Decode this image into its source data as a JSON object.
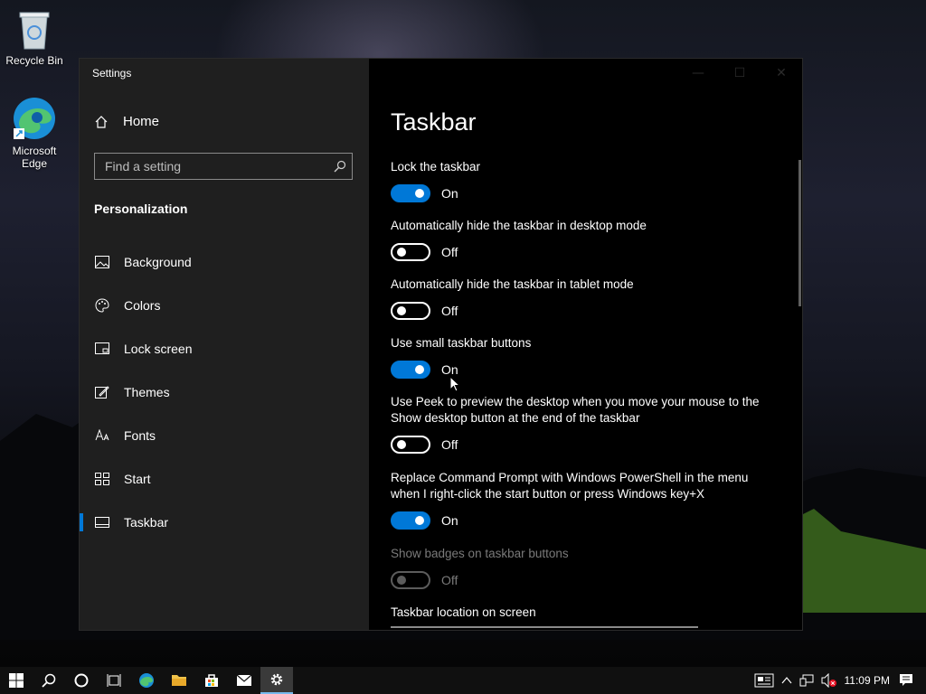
{
  "desktop": {
    "icons": [
      {
        "label": "Recycle Bin"
      },
      {
        "label_line1": "Microsoft",
        "label_line2": "Edge"
      }
    ]
  },
  "window": {
    "title": "Settings",
    "controls": {
      "minimize": "—",
      "maximize": "☐",
      "close": "✕"
    }
  },
  "nav": {
    "home_label": "Home",
    "search_placeholder": "Find a setting",
    "section_title": "Personalization",
    "items": [
      {
        "label": "Background",
        "icon": "picture-icon"
      },
      {
        "label": "Colors",
        "icon": "palette-icon"
      },
      {
        "label": "Lock screen",
        "icon": "lock-screen-icon"
      },
      {
        "label": "Themes",
        "icon": "themes-icon"
      },
      {
        "label": "Fonts",
        "icon": "fonts-icon"
      },
      {
        "label": "Start",
        "icon": "start-icon"
      },
      {
        "label": "Taskbar",
        "icon": "taskbar-icon",
        "active": true
      }
    ]
  },
  "content": {
    "title": "Taskbar",
    "settings": [
      {
        "label": "Lock the taskbar",
        "state": "On"
      },
      {
        "label": "Automatically hide the taskbar in desktop mode",
        "state": "Off"
      },
      {
        "label": "Automatically hide the taskbar in tablet mode",
        "state": "Off"
      },
      {
        "label": "Use small taskbar buttons",
        "state": "On"
      },
      {
        "label_line1": "Use Peek to preview the desktop when you move your mouse to the",
        "label_line2": "Show desktop button at the end of the taskbar",
        "state": "Off"
      },
      {
        "label_line1": "Replace Command Prompt with Windows PowerShell in the menu",
        "label_line2": "when I right-click the start button or press Windows key+X",
        "state": "On"
      },
      {
        "label": "Show badges on taskbar buttons",
        "state": "Off",
        "disabled": true
      },
      {
        "label": "Taskbar location on screen"
      }
    ]
  },
  "taskbar": {
    "clock": "11:09 PM",
    "accent": "#0078d7"
  }
}
